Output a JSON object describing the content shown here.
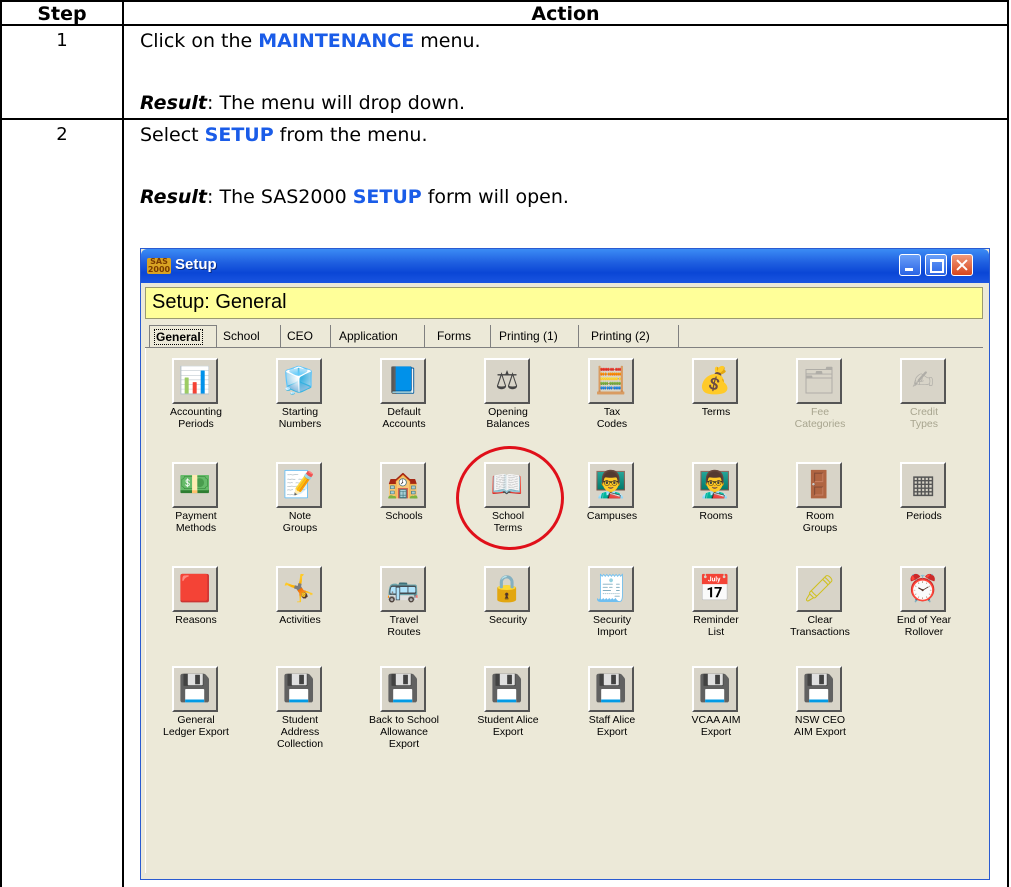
{
  "table": {
    "headers": {
      "step": "Step",
      "action": "Action"
    },
    "rows": [
      {
        "step": "1",
        "line1_pre": "Click on the ",
        "line1_kw": "MAINTENANCE",
        "line1_post": " menu.",
        "result_label": "Result",
        "result_text": ": The menu will drop down."
      },
      {
        "step": "2",
        "line1_pre": "Select ",
        "line1_kw": "SETUP",
        "line1_post": " from the menu.",
        "result_label": "Result",
        "result_pre": ": The SAS2000 ",
        "result_kw": "SETUP",
        "result_post": " form will open."
      }
    ]
  },
  "window": {
    "logo_text": "SAS 2000",
    "title": "Setup",
    "header": "Setup: General",
    "tabs": [
      "General",
      "School",
      "CEO",
      "Application",
      "Forms",
      "Printing (1)",
      "Printing (2)"
    ],
    "active_tab": "General",
    "icons": [
      {
        "label": "Accounting\nPeriods",
        "icon": "chart-icon"
      },
      {
        "label": "Starting\nNumbers",
        "icon": "blocks-icon"
      },
      {
        "label": "Default\nAccounts",
        "icon": "book-icon"
      },
      {
        "label": "Opening\nBalances",
        "icon": "scales-icon"
      },
      {
        "label": "Tax\nCodes",
        "icon": "calculator-icon"
      },
      {
        "label": "Terms",
        "icon": "money-bag-icon"
      },
      {
        "label": "Fee\nCategories",
        "icon": "folders-icon",
        "disabled": true
      },
      {
        "label": "Credit\nTypes",
        "icon": "pen-paper-icon",
        "disabled": true
      },
      {
        "label": "Payment\nMethods",
        "icon": "money-hand-icon"
      },
      {
        "label": "Note\nGroups",
        "icon": "note-pin-icon"
      },
      {
        "label": "Schools",
        "icon": "school-icon"
      },
      {
        "label": "School\nTerms",
        "icon": "open-book-icon"
      },
      {
        "label": "Campuses",
        "icon": "teacher-board-icon"
      },
      {
        "label": "Rooms",
        "icon": "teacher-board-icon"
      },
      {
        "label": "Room\nGroups",
        "icon": "doors-icon"
      },
      {
        "label": "Periods",
        "icon": "grid-calendar-icon"
      },
      {
        "label": "Reasons",
        "icon": "stacked-blocks-icon"
      },
      {
        "label": "Activities",
        "icon": "figure-icon"
      },
      {
        "label": "Travel\nRoutes",
        "icon": "bus-icon"
      },
      {
        "label": "Security",
        "icon": "padlock-icon"
      },
      {
        "label": "Security\nImport",
        "icon": "cheque-import-icon"
      },
      {
        "label": "Reminder\nList",
        "icon": "calendar-icon"
      },
      {
        "label": "Clear\nTransactions",
        "icon": "eraser-icon"
      },
      {
        "label": "End of Year\nRollover",
        "icon": "clock-icon"
      },
      {
        "label": "General\nLedger Export",
        "icon": "floppy-icon"
      },
      {
        "label": "Student\nAddress\nCollection",
        "icon": "floppy-house-icon"
      },
      {
        "label": "Back to School\nAllowance\nExport",
        "icon": "floppy-icon"
      },
      {
        "label": "Student Alice\nExport",
        "icon": "floppy-icon"
      },
      {
        "label": "Staff Alice\nExport",
        "icon": "floppy-icon"
      },
      {
        "label": "VCAA AIM\nExport",
        "icon": "floppy-icon"
      },
      {
        "label": "NSW CEO\nAIM Export",
        "icon": "floppy-icon"
      }
    ]
  },
  "colors": {
    "keyword": "#1a5ce8",
    "titlebar": "#0a46d6",
    "header_band": "#ffff99",
    "highlight_circle": "#e0101a"
  }
}
